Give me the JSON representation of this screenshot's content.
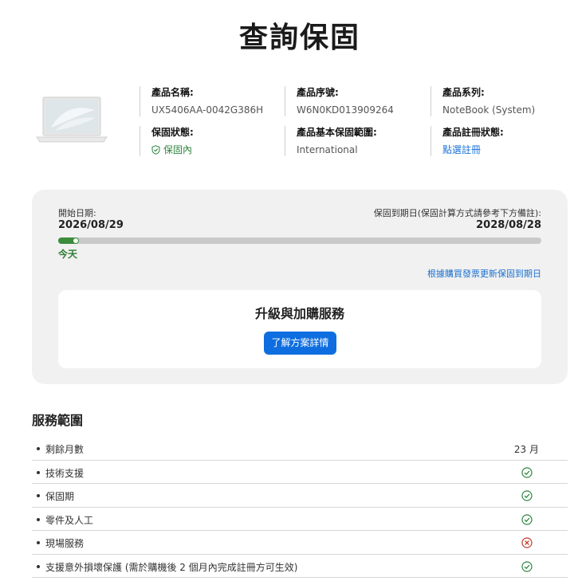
{
  "page": {
    "title": "查詢保固"
  },
  "product": {
    "name_label": "產品名稱:",
    "name_value": "UX5406AA-0042G386H",
    "serial_label": "產品序號:",
    "serial_value": "W6N0KD013909264",
    "series_label": "產品系列:",
    "series_value": "NoteBook (System)",
    "status_label": "保固狀態:",
    "status_value": "保固內",
    "scope_label": "產品基本保固範圍:",
    "scope_value": "International",
    "registration_label": "產品註冊狀態:",
    "registration_value": "點選註冊"
  },
  "warranty": {
    "start_label": "開始日期:",
    "start_date": "2026/08/29",
    "end_label": "保固到期日(保固計算方式請參考下方備註):",
    "end_date": "2028/08/28",
    "progress_fraction": 0.03,
    "today_label": "今天",
    "update_link": "根據購買發票更新保固到期日"
  },
  "upgrade": {
    "title": "升級與加購服務",
    "button_label": "了解方案詳情"
  },
  "services": {
    "title": "服務範圍",
    "rows": [
      {
        "label": "剩餘月數",
        "value": "23 月"
      },
      {
        "label": "技術支援",
        "status": "check"
      },
      {
        "label": "保固期",
        "status": "check"
      },
      {
        "label": "零件及人工",
        "status": "check"
      },
      {
        "label": "現場服務",
        "status": "cross"
      },
      {
        "label": "支援意外損壞保護 (需於購機後 2 個月內完成註冊方可生效)",
        "status": "check"
      }
    ]
  },
  "colors": {
    "accent_blue": "#0e6ee0",
    "link_blue": "#1a73d9",
    "check_green": "#2e8540",
    "cross_red": "#c0392b",
    "progress_green": "#3b8c3b"
  }
}
